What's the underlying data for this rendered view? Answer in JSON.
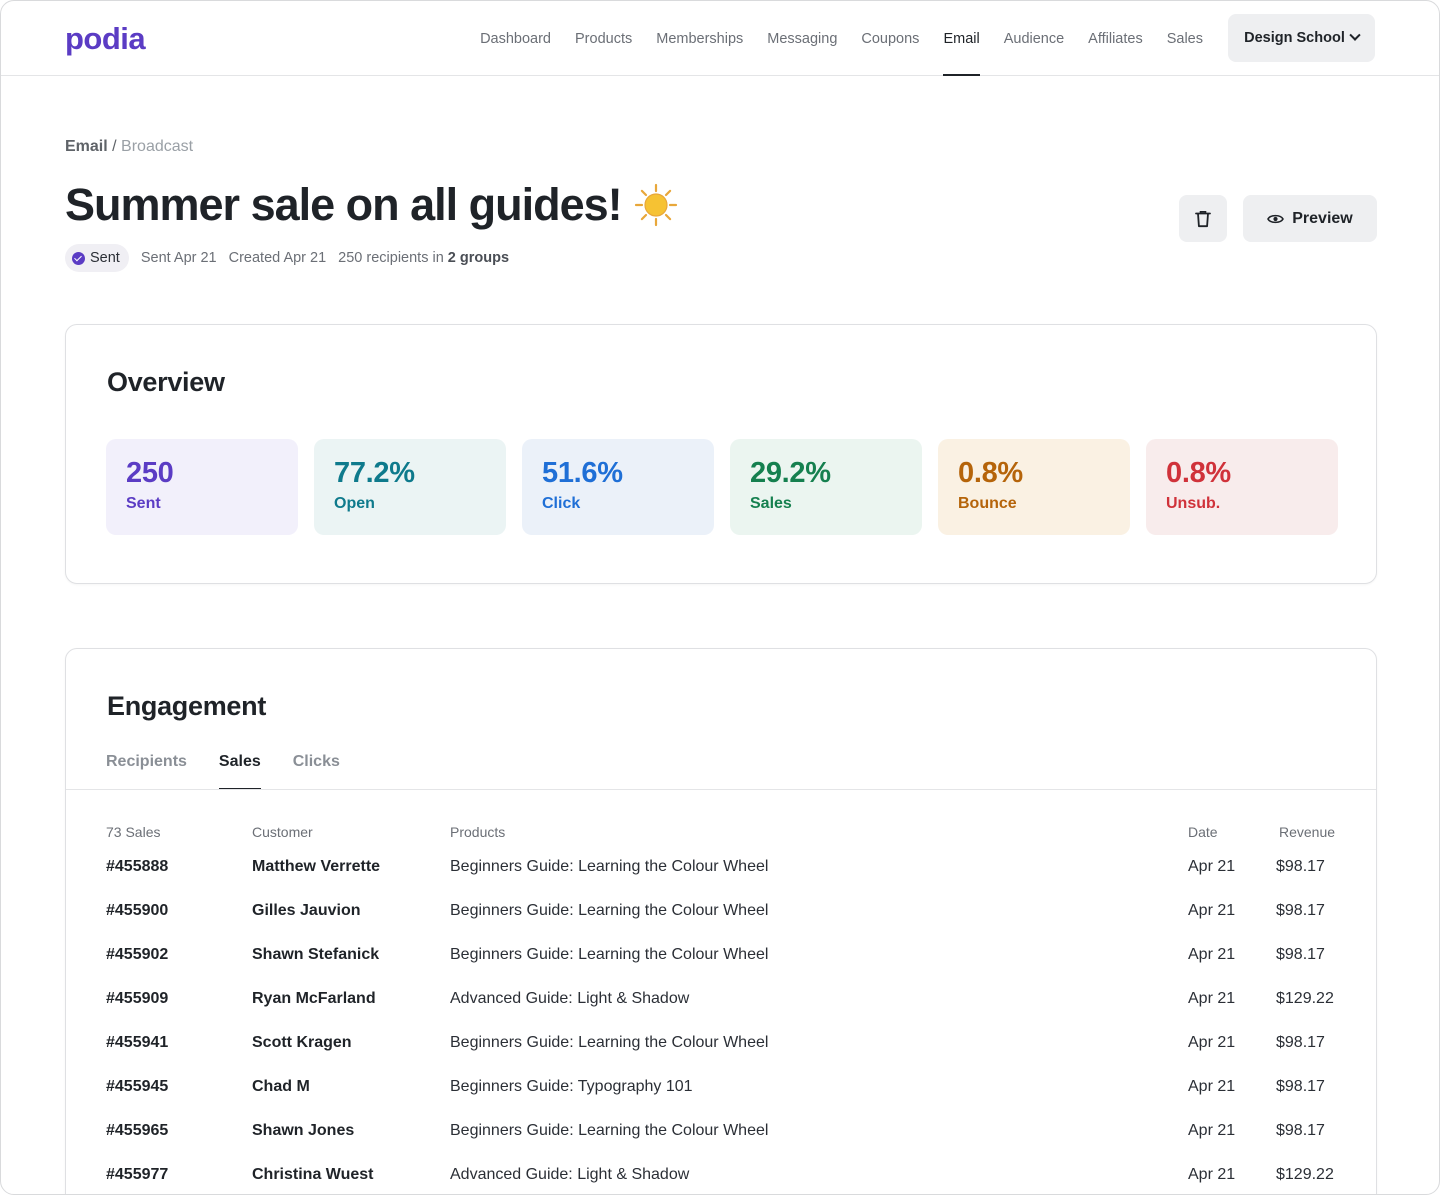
{
  "brand": {
    "logo": "podia",
    "color": "#5b3cc4"
  },
  "nav": {
    "links": [
      "Dashboard",
      "Products",
      "Memberships",
      "Messaging",
      "Coupons",
      "Email",
      "Audience",
      "Affiliates",
      "Sales"
    ],
    "active": "Email",
    "account_label": "Design School"
  },
  "breadcrumb": {
    "root": "Email",
    "separator": "/",
    "leaf": "Broadcast"
  },
  "page": {
    "title": "Summer sale on all guides!",
    "title_icon": "sun-icon",
    "status": "Sent",
    "sent_on": "Sent Apr 21",
    "created_on": "Created Apr 21",
    "recipients_text": "250 recipients in",
    "groups_text": "2 groups"
  },
  "actions": {
    "delete_icon": "trash-icon",
    "preview_label": "Preview",
    "preview_icon": "eye-icon"
  },
  "overview": {
    "title": "Overview",
    "stats": [
      {
        "value": "250",
        "label": "Sent",
        "color": "#5b3cc4",
        "bg": "#f2f0fb"
      },
      {
        "value": "77.2%",
        "label": "Open",
        "color": "#0e7a8c",
        "bg": "#ebf4f4"
      },
      {
        "value": "51.6%",
        "label": "Click",
        "color": "#1f6fd6",
        "bg": "#ebf1f9"
      },
      {
        "value": "29.2%",
        "label": "Sales",
        "color": "#15804f",
        "bg": "#ebf5f0"
      },
      {
        "value": "0.8%",
        "label": "Bounce",
        "color": "#b5640a",
        "bg": "#faf1e3"
      },
      {
        "value": "0.8%",
        "label": "Unsub.",
        "color": "#d0323a",
        "bg": "#f8ecec"
      }
    ]
  },
  "engagement": {
    "title": "Engagement",
    "tabs": [
      "Recipients",
      "Sales",
      "Clicks"
    ],
    "active_tab": "Sales",
    "columns": {
      "count": "73 Sales",
      "customer": "Customer",
      "products": "Products",
      "date": "Date",
      "revenue": "Revenue"
    },
    "rows": [
      {
        "id": "#455888",
        "customer": "Matthew Verrette",
        "product": "Beginners Guide: Learning the Colour Wheel",
        "date": "Apr 21",
        "revenue": "$98.17"
      },
      {
        "id": "#455900",
        "customer": "Gilles Jauvion",
        "product": "Beginners Guide: Learning the Colour Wheel",
        "date": "Apr 21",
        "revenue": "$98.17"
      },
      {
        "id": "#455902",
        "customer": "Shawn Stefanick",
        "product": "Beginners Guide: Learning the Colour Wheel",
        "date": "Apr 21",
        "revenue": "$98.17"
      },
      {
        "id": "#455909",
        "customer": "Ryan McFarland",
        "product": "Advanced Guide: Light & Shadow",
        "date": "Apr 21",
        "revenue": "$129.22"
      },
      {
        "id": "#455941",
        "customer": "Scott Kragen",
        "product": "Beginners Guide: Learning the Colour Wheel",
        "date": "Apr 21",
        "revenue": "$98.17"
      },
      {
        "id": "#455945",
        "customer": "Chad M",
        "product": "Beginners Guide: Typography 101",
        "date": "Apr 21",
        "revenue": "$98.17"
      },
      {
        "id": "#455965",
        "customer": "Shawn Jones",
        "product": "Beginners Guide: Learning the Colour Wheel",
        "date": "Apr 21",
        "revenue": "$98.17"
      },
      {
        "id": "#455977",
        "customer": "Christina Wuest",
        "product": "Advanced Guide: Light & Shadow",
        "date": "Apr 21",
        "revenue": "$129.22"
      }
    ]
  }
}
